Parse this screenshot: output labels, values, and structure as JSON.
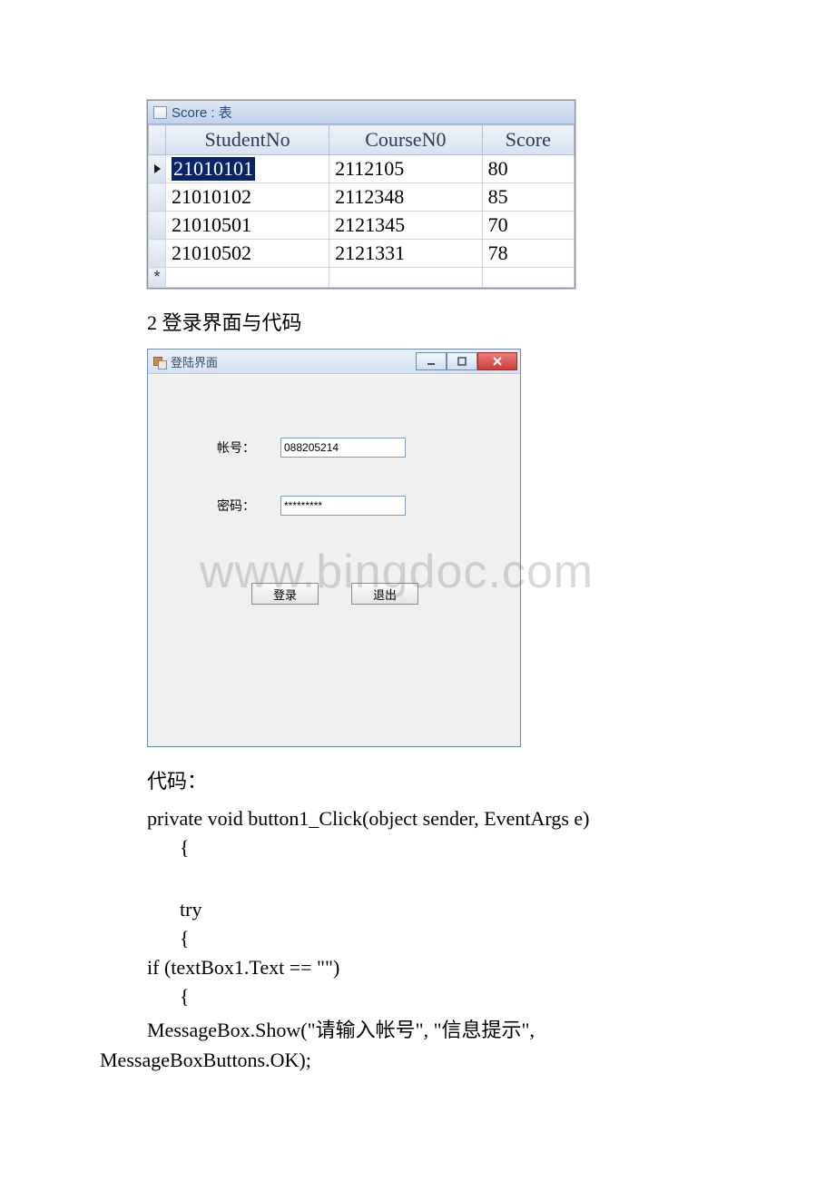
{
  "access": {
    "title": "Score : 表",
    "columns": [
      "StudentNo",
      "CourseN0",
      "Score"
    ],
    "rows": [
      {
        "selected": true,
        "c1": "21010101",
        "c2": "2112105",
        "c3": "80"
      },
      {
        "selected": false,
        "c1": "21010102",
        "c2": "2112348",
        "c3": "85"
      },
      {
        "selected": false,
        "c1": "21010501",
        "c2": "2121345",
        "c3": "70"
      },
      {
        "selected": false,
        "c1": "21010502",
        "c2": "2121331",
        "c3": "78"
      }
    ],
    "new_row_marker": "*"
  },
  "section2_heading": "2 登录界面与代码",
  "login": {
    "window_title": "登陆界面",
    "account_label": "帐号：",
    "account_value": "088205214",
    "password_label": "密码：",
    "password_value": "*********",
    "login_button": "登录",
    "exit_button": "退出"
  },
  "watermark": "www.bingdoc.com",
  "code": {
    "label": "代码：",
    "line1": "private void button1_Click(object sender, EventArgs e)",
    "line2": "{",
    "line3": " try",
    "line4": " {",
    "line5": "if (textBox1.Text == \"\")",
    "line6": " {",
    "line7a": " MessageBox.Show(\"请输入帐号\", \"信息提示\",",
    "line7b": "MessageBoxButtons.OK);"
  }
}
